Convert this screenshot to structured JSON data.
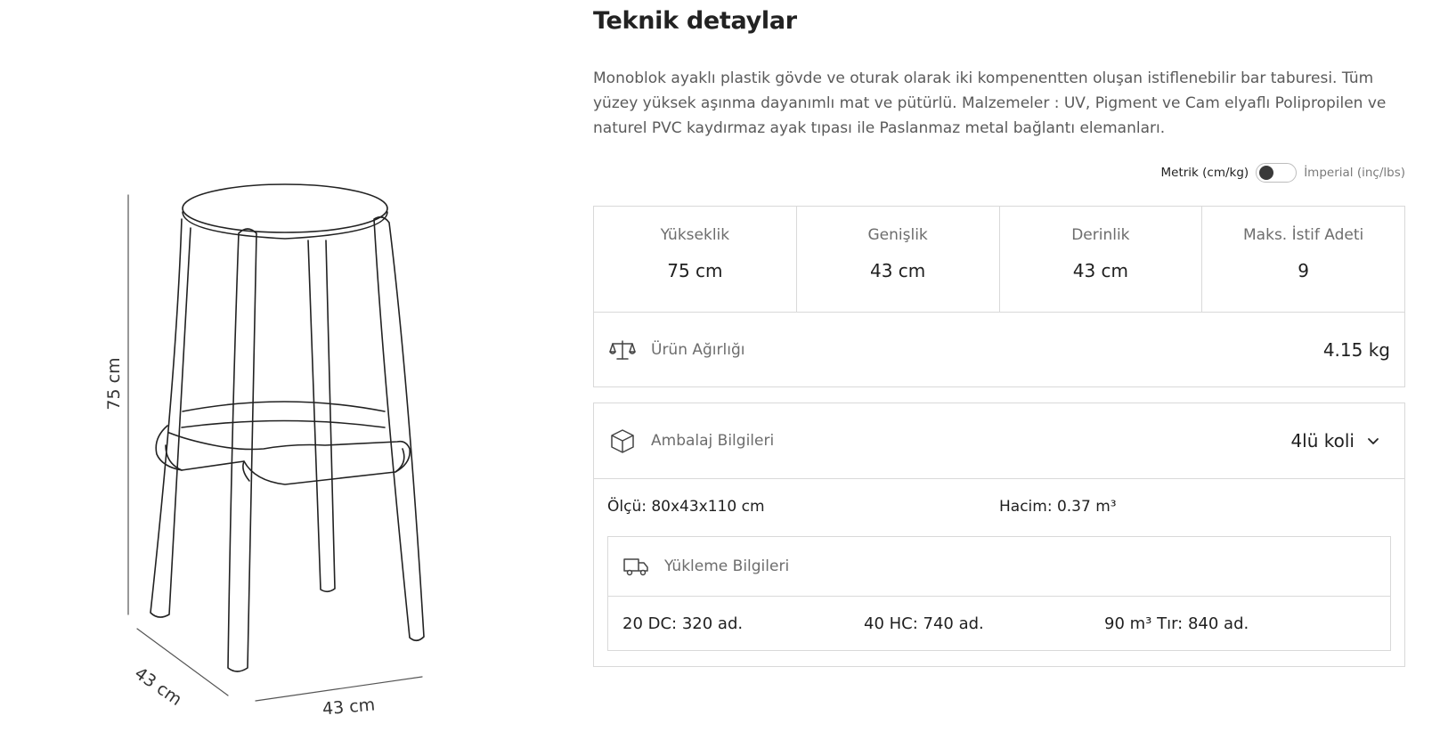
{
  "drawing": {
    "height_label": "75 cm",
    "depth_label": "43 cm",
    "width_label": "43 cm"
  },
  "panel": {
    "title": "Teknik detaylar",
    "description": "Monoblok ayaklı plastik gövde ve oturak olarak iki kompenentten oluşan istiflenebilir bar taburesi. Tüm yüzey yüksek aşınma dayanımlı mat ve pütürlü. Malzemeler : UV, Pigment ve Cam elyaflı Polipropilen ve naturel PVC kaydırmaz ayak tıpası ile Paslanmaz metal bağlantı elemanları."
  },
  "units": {
    "metric": "Metrik (cm/kg)",
    "imperial": "İmperial (inç/lbs)"
  },
  "dimensions": [
    {
      "label": "Yükseklik",
      "value": "75 cm"
    },
    {
      "label": "Genişlik",
      "value": "43 cm"
    },
    {
      "label": "Derinlik",
      "value": "43 cm"
    },
    {
      "label": "Maks. İstif Adeti",
      "value": "9"
    }
  ],
  "weight": {
    "icon": "scale-icon",
    "label": "Ürün Ağırlığı",
    "value": "4.15 kg"
  },
  "packaging": {
    "icon": "box-icon",
    "label": "Ambalaj Bilgileri",
    "selected": "4lü koli",
    "size": "Ölçü: 80x43x110 cm",
    "volume": "Hacim: 0.37 m³"
  },
  "loading": {
    "icon": "truck-icon",
    "label": "Yükleme Bilgileri",
    "items": [
      "20 DC: 320 ad.",
      "40 HC: 740 ad.",
      "90 m³ Tır: 840 ad."
    ]
  }
}
